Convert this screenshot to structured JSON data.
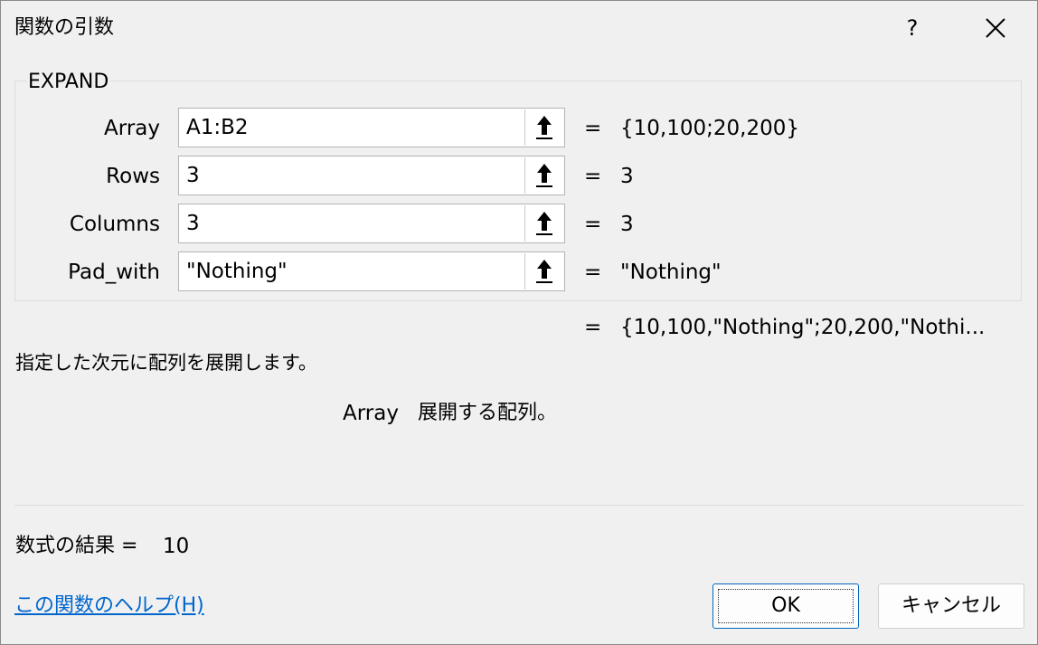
{
  "window": {
    "title": "関数の引数",
    "help_label": "?"
  },
  "function": {
    "name": "EXPAND"
  },
  "arguments": [
    {
      "label": "Array",
      "input": "A1:B2",
      "eq": "=",
      "value": "{10,100;20,200}"
    },
    {
      "label": "Rows",
      "input": "3",
      "eq": "=",
      "value": "3"
    },
    {
      "label": "Columns",
      "input": "3",
      "eq": "=",
      "value": "3"
    },
    {
      "label": "Pad_with",
      "input": "\"Nothing\"",
      "eq": "=",
      "value": "\"Nothing\""
    }
  ],
  "formula_result_preview": {
    "eq": "=",
    "value": "{10,100,\"Nothing\";20,200,\"Nothi..."
  },
  "description": "指定した次元に配列を展開します。",
  "arg_description": {
    "name": "Array",
    "text": "展開する配列。"
  },
  "result": {
    "label": "数式の結果 =",
    "value": "10"
  },
  "help_link": "この関数のヘルプ(H)",
  "buttons": {
    "ok": "OK",
    "cancel": "キャンセル"
  },
  "colors": {
    "background": "#f0f0f0",
    "link": "#0066cc",
    "ok_border": "#0067c0"
  }
}
